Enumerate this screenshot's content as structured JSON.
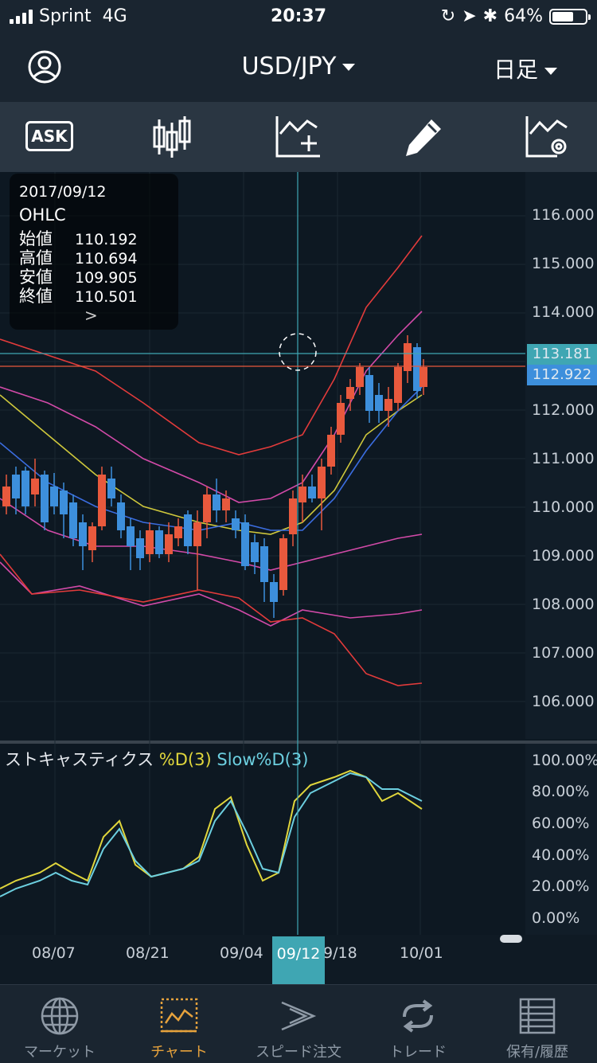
{
  "status": {
    "carrier": "Sprint",
    "network": "4G",
    "time": "20:37",
    "battery": "64%",
    "battery_level": 0.64
  },
  "header": {
    "title": "USD/JPY",
    "period": "日足"
  },
  "toolbar": {
    "ask_label": "ASK"
  },
  "info": {
    "date": "2017/09/12",
    "heading": "OHLC",
    "rows": [
      {
        "label": "始値",
        "value": "110.192"
      },
      {
        "label": "高値",
        "value": "110.694"
      },
      {
        "label": "安値",
        "value": "109.905"
      },
      {
        "label": "終値",
        "value": "110.501"
      }
    ],
    "more": ">"
  },
  "price_axis": [
    "116.000",
    "115.000",
    "114.000",
    "112.000",
    "111.000",
    "110.000",
    "109.000",
    "108.000",
    "107.000",
    "106.000"
  ],
  "price_tags": {
    "ask": "113.181",
    "bid": "112.922"
  },
  "stoch": {
    "name": "ストキャスティクス",
    "d_label": "%D(3)",
    "slow_label": "Slow%D(3)",
    "axis": [
      "100.00%",
      "80.00%",
      "60.00%",
      "40.00%",
      "20.00%",
      "0.00%"
    ]
  },
  "dates": {
    "d1": "08/07",
    "d2": "08/21",
    "d3": "09/04",
    "selected": "09/12",
    "d4": "9/18",
    "d5": "10/01"
  },
  "tabs": [
    "マーケット",
    "チャート",
    "スピード注文",
    "トレード",
    "保有/履歴"
  ],
  "colors": {
    "up": "#e8593d",
    "down": "#3d8fdc",
    "crosshair": "#3fa6b3",
    "stoch_d": "#e0d63c",
    "stoch_slow": "#6ccfe0",
    "active_tab": "#e6a23c"
  }
}
